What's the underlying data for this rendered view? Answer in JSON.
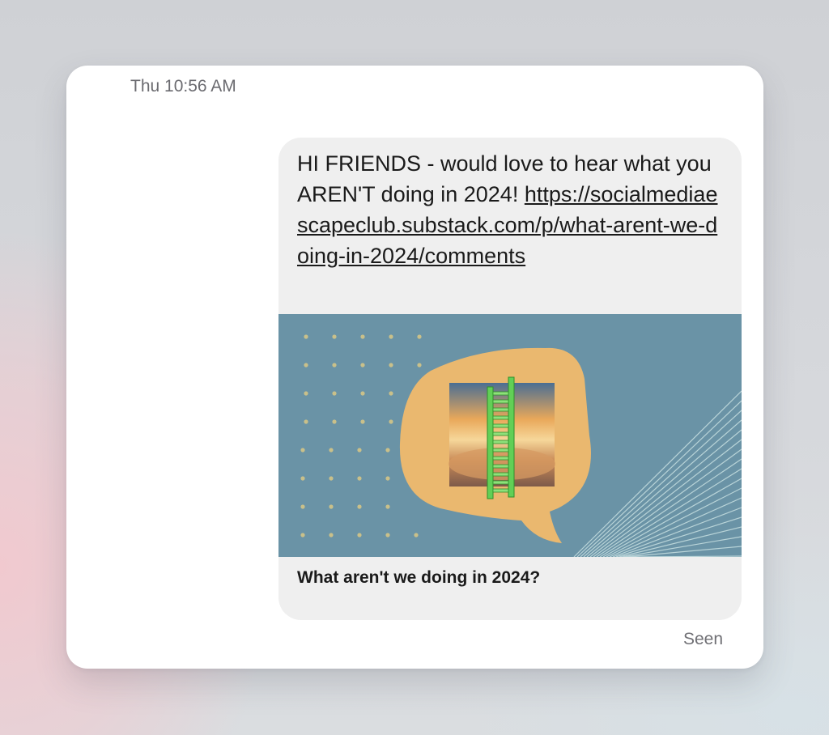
{
  "conversation": {
    "timestamp": "Thu 10:56 AM",
    "message": {
      "text": "HI FRIENDS - would love to hear what you AREN'T doing in 2024!",
      "link": "https://socialmediaescapeclub.substack.com/p/what-arent-we-doing-in-2024/comments"
    },
    "preview": {
      "title": "What aren't we doing in 2024?",
      "image_icon": "ladder-speech-bubble-illustration"
    },
    "status": "Seen"
  },
  "colors": {
    "bubble_bg": "#efefef",
    "preview_bg": "#6a93a6",
    "speech_bubble": "#eab86f",
    "ladder": "#62cf56"
  }
}
